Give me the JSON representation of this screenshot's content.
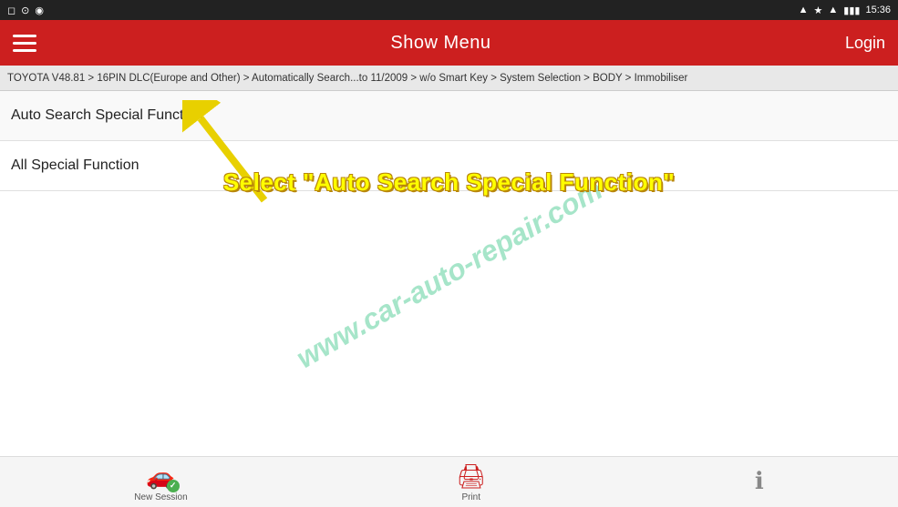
{
  "statusBar": {
    "leftIcons": [
      "◻",
      "◉",
      "⊙"
    ],
    "time": "15:36",
    "rightIcons": [
      "▲",
      "bluetooth",
      "wifi",
      "battery"
    ]
  },
  "navBar": {
    "title": "Show Menu",
    "loginLabel": "Login"
  },
  "breadcrumb": {
    "text": "TOYOTA V48.81 > 16PIN DLC(Europe and Other) > Automatically Search...to 11/2009 > w/o Smart Key > System Selection > BODY > Immobiliser"
  },
  "menuItems": [
    {
      "label": "Auto Search Special Function"
    },
    {
      "label": "All Special Function"
    }
  ],
  "watermark": "www.car-auto-repair.com",
  "instructionText": "Select \"Auto Search Special Function\"",
  "bottomBar": {
    "buttons": [
      {
        "label": "New Session",
        "icon": "🚗"
      },
      {
        "label": "Print",
        "icon": "🖨"
      },
      {
        "label": "Info",
        "icon": "ℹ"
      }
    ]
  }
}
